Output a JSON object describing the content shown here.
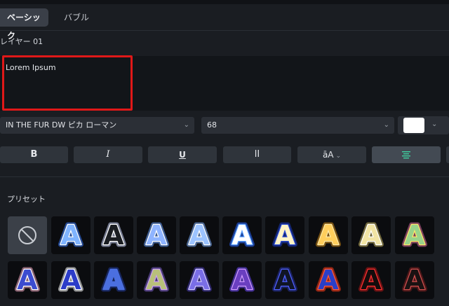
{
  "tabs": [
    {
      "label": "ベーシック",
      "active": true
    },
    {
      "label": "バブル",
      "active": false
    }
  ],
  "layer_title": "レイヤー 01",
  "text_input": {
    "value": "Lorem Ipsum"
  },
  "font_select": {
    "value": "IN THE FUR DW ピカ ローマン"
  },
  "size_select": {
    "value": "68"
  },
  "color": {
    "value": "#ffffff"
  },
  "format_buttons": [
    {
      "label": "B",
      "name": "bold"
    },
    {
      "label": "I",
      "name": "italic"
    },
    {
      "label": "U",
      "name": "underline"
    },
    {
      "label": "lI",
      "name": "spacing"
    },
    {
      "label": "ā",
      "name": "case"
    },
    {
      "label": "",
      "name": "align"
    }
  ],
  "presets": {
    "label": "プリセット",
    "glyph": "A",
    "row1": [
      {
        "style": "none"
      },
      {
        "fill": "#7fb3ff",
        "stroke": "#ffffff",
        "glow": "#3a7bff"
      },
      {
        "fill": "#1a1d22",
        "stroke": "#ffffff",
        "glow": "#cfd8ff"
      },
      {
        "fill": "#8fb4ff",
        "stroke": "#ffffff",
        "glow": "#6aa0ff"
      },
      {
        "fill": "#9cc3ff",
        "stroke": "#ffffff",
        "glow": "#7fb0ff"
      },
      {
        "fill": "#ffffff",
        "stroke": "#5aa0ff",
        "glow": "#2a64ff"
      },
      {
        "fill": "#fff3c6",
        "stroke": "#2b4bd6",
        "glow": "#1e3bbb"
      },
      {
        "fill": "#ffce5c",
        "stroke": "#ffe9a8",
        "glow": "#d08a18"
      },
      {
        "fill": "#f1e4a4",
        "stroke": "#ffffff",
        "glow": "#c9b764"
      },
      {
        "fill": "#9ad38a",
        "stroke": "#ffe66a",
        "glow": "#d86aa0"
      }
    ],
    "row2": [
      {
        "fill": "#3c4cd0",
        "stroke": "#ffffff",
        "glow": "#f2a7c3"
      },
      {
        "fill": "#2c3cc8",
        "stroke": "#ffffff",
        "glow": "#ffffff"
      },
      {
        "fill": "#4b6fe0",
        "stroke": "#4b6fe0",
        "glow": "#223a9a"
      },
      {
        "fill": "#b8c07a",
        "stroke": "#c9a0f0",
        "glow": "#7b5fc9"
      },
      {
        "fill": "#7a6ee6",
        "stroke": "#d0c6ff",
        "glow": "#4b3db8"
      },
      {
        "fill": "#6a3fc0",
        "stroke": "#d29bff",
        "glow": "#6d49ff"
      },
      {
        "fill": "#101525",
        "stroke": "#5060ff",
        "glow": "#2a34a0"
      },
      {
        "fill": "#2a3fc8",
        "stroke": "#ff5a3a",
        "glow": "#ff3a1a"
      },
      {
        "fill": "#140c0c",
        "stroke": "#ff3030",
        "glow": "#b01818"
      },
      {
        "fill": "#1a1212",
        "stroke": "#d05050",
        "glow": "#802020"
      }
    ]
  }
}
